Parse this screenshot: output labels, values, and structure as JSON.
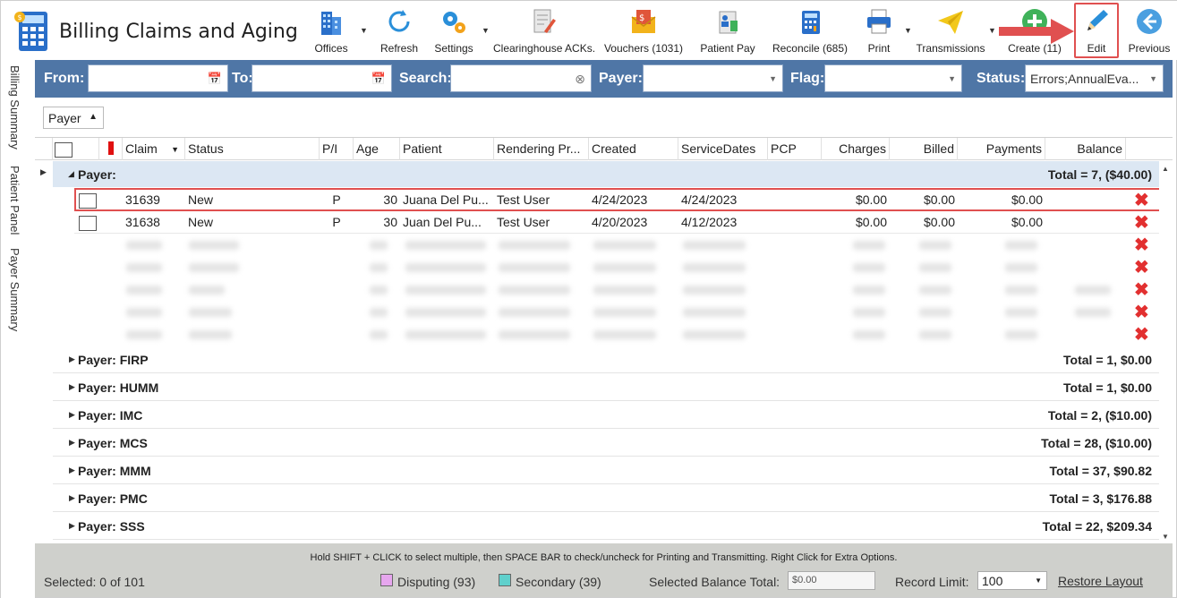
{
  "app": {
    "title": "Billing Claims and Aging"
  },
  "toolbar": {
    "buttons": [
      {
        "label": "Offices",
        "icon": "buildings-icon"
      },
      {
        "label": "Refresh",
        "icon": "refresh-icon"
      },
      {
        "label": "Settings",
        "icon": "gears-icon"
      },
      {
        "label": "Clearinghouse ACKs.",
        "icon": "document-pen-icon"
      },
      {
        "label": "Vouchers (1031)",
        "icon": "voucher-envelope-icon"
      },
      {
        "label": "Patient Pay",
        "icon": "patient-pay-icon"
      },
      {
        "label": "Reconcile (685)",
        "icon": "calculator-icon"
      },
      {
        "label": "Print",
        "icon": "printer-icon"
      },
      {
        "label": "Transmissions",
        "icon": "paper-plane-icon"
      },
      {
        "label": "Create (11)",
        "icon": "plus-circle-icon"
      },
      {
        "label": "Edit",
        "icon": "pencil-icon"
      },
      {
        "label": "Previous",
        "icon": "back-arrow-icon"
      }
    ]
  },
  "side_tabs": [
    "Billing Summary",
    "Patient Panel",
    "Payer Summary"
  ],
  "filters": {
    "from_label": "From:",
    "from_value": "",
    "to_label": "To:",
    "to_value": "",
    "search_label": "Search:",
    "search_value": "",
    "payer_label": "Payer:",
    "payer_value": "",
    "flag_label": "Flag:",
    "flag_value": "",
    "status_label": "Status:",
    "status_value": "Errors;AnnualEva..."
  },
  "group_by": {
    "label": "Payer"
  },
  "columns": [
    "Claim",
    "Status",
    "P/I",
    "Age",
    "Patient",
    "Rendering Pr...",
    "Created",
    "ServiceDates",
    "PCP",
    "Charges",
    "Billed",
    "Payments",
    "Balance"
  ],
  "groups": [
    {
      "label": "Payer:",
      "total": "Total = 7,  ($40.00)",
      "expanded": true,
      "rows": [
        {
          "claim": "31639",
          "status": "New",
          "pi": "P",
          "age": "30",
          "patient": "Juana Del Pu...",
          "rendering": "Test User",
          "created": "4/24/2023",
          "service": "4/24/2023",
          "pcp": "",
          "charges": "$0.00",
          "billed": "$0.00",
          "payments": "$0.00",
          "balance": ""
        },
        {
          "claim": "31638",
          "status": "New",
          "pi": "P",
          "age": "30",
          "patient": "Juan  Del Pu...",
          "rendering": "Test User",
          "created": "4/20/2023",
          "service": "4/12/2023",
          "pcp": "",
          "charges": "$0.00",
          "billed": "$0.00",
          "payments": "$0.00",
          "balance": ""
        }
      ]
    },
    {
      "label": "Payer: FIRP",
      "total": "Total = 1,  $0.00"
    },
    {
      "label": "Payer: HUMM",
      "total": "Total = 1,  $0.00"
    },
    {
      "label": "Payer: IMC",
      "total": "Total = 2,  ($10.00)"
    },
    {
      "label": "Payer: MCS",
      "total": "Total = 28,  ($10.00)"
    },
    {
      "label": "Payer: MMM",
      "total": "Total = 37,  $90.82"
    },
    {
      "label": "Payer: PMC",
      "total": "Total = 3,  $176.88"
    },
    {
      "label": "Payer: SSS",
      "total": "Total = 22,  $209.34"
    }
  ],
  "status": {
    "hint": "Hold SHIFT + CLICK to select multiple, then SPACE BAR to check/uncheck for Printing and Transmitting. Right Click for Extra Options.",
    "selected": "Selected: 0 of 101",
    "disputing": "Disputing (93)",
    "secondary": "Secondary (39)",
    "selected_balance_label": "Selected Balance Total:",
    "selected_balance_value": "$0.00",
    "record_limit_label": "Record Limit:",
    "record_limit_value": "100",
    "restore_layout": "Restore Layout"
  },
  "colors": {
    "filter_bar": "#4f76a6",
    "group_highlight": "#dce7f3",
    "disputing": "#e6a6ee",
    "secondary": "#5fd0cc",
    "delete_red": "#e23030",
    "annotation_red": "#e05050"
  }
}
